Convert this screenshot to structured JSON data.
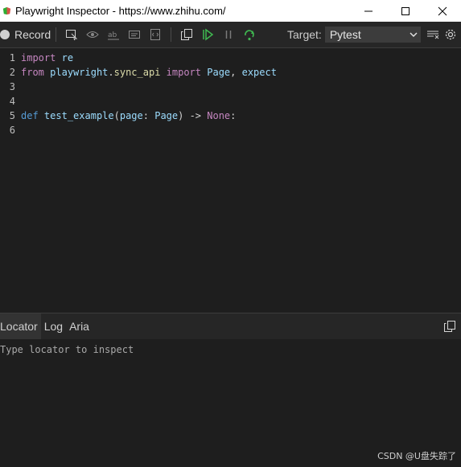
{
  "window": {
    "title": "Playwright Inspector - https://www.zhihu.com/",
    "controls": [
      "minimize",
      "maximize",
      "close"
    ]
  },
  "toolbar": {
    "record_label": "Record",
    "target_label": "Target:",
    "target_value": "Pytest",
    "icons": [
      "pick-locator-icon",
      "assert-visibility-icon",
      "assert-text-icon",
      "assert-value-icon",
      "assert-snapshot-icon",
      "copy-icon",
      "resume-icon",
      "pause-icon",
      "step-over-icon",
      "clear-icon",
      "settings-icon"
    ],
    "colors": {
      "resume": "#3fb950",
      "step": "#3fb950"
    }
  },
  "code": {
    "lines": [
      {
        "n": "1",
        "tokens": [
          {
            "t": "import",
            "c": "kw"
          },
          {
            "t": " ",
            "c": "pl"
          },
          {
            "t": "re",
            "c": "id"
          }
        ]
      },
      {
        "n": "2",
        "tokens": [
          {
            "t": "from",
            "c": "kw"
          },
          {
            "t": " ",
            "c": "pl"
          },
          {
            "t": "playwright",
            "c": "id"
          },
          {
            "t": ".",
            "c": "pl"
          },
          {
            "t": "sync_api",
            "c": "fn"
          },
          {
            "t": " ",
            "c": "pl"
          },
          {
            "t": "import",
            "c": "kw"
          },
          {
            "t": " ",
            "c": "pl"
          },
          {
            "t": "Page",
            "c": "id"
          },
          {
            "t": ", ",
            "c": "pl"
          },
          {
            "t": "expect",
            "c": "id"
          }
        ]
      },
      {
        "n": "3",
        "tokens": []
      },
      {
        "n": "4",
        "tokens": []
      },
      {
        "n": "5",
        "tokens": [
          {
            "t": "def",
            "c": "kw2"
          },
          {
            "t": " ",
            "c": "pl"
          },
          {
            "t": "test_example",
            "c": "id"
          },
          {
            "t": "(",
            "c": "pl"
          },
          {
            "t": "page",
            "c": "id"
          },
          {
            "t": ": ",
            "c": "pl"
          },
          {
            "t": "Page",
            "c": "id"
          },
          {
            "t": ") -> ",
            "c": "pl"
          },
          {
            "t": "None",
            "c": "kw"
          },
          {
            "t": ":",
            "c": "pl"
          }
        ]
      },
      {
        "n": "6",
        "tokens": []
      }
    ]
  },
  "panel": {
    "tabs": [
      "Locator",
      "Log",
      "Aria"
    ],
    "active_tab": "Locator",
    "locator_placeholder": "Type locator to inspect"
  },
  "watermark": "CSDN @U盘失踪了"
}
